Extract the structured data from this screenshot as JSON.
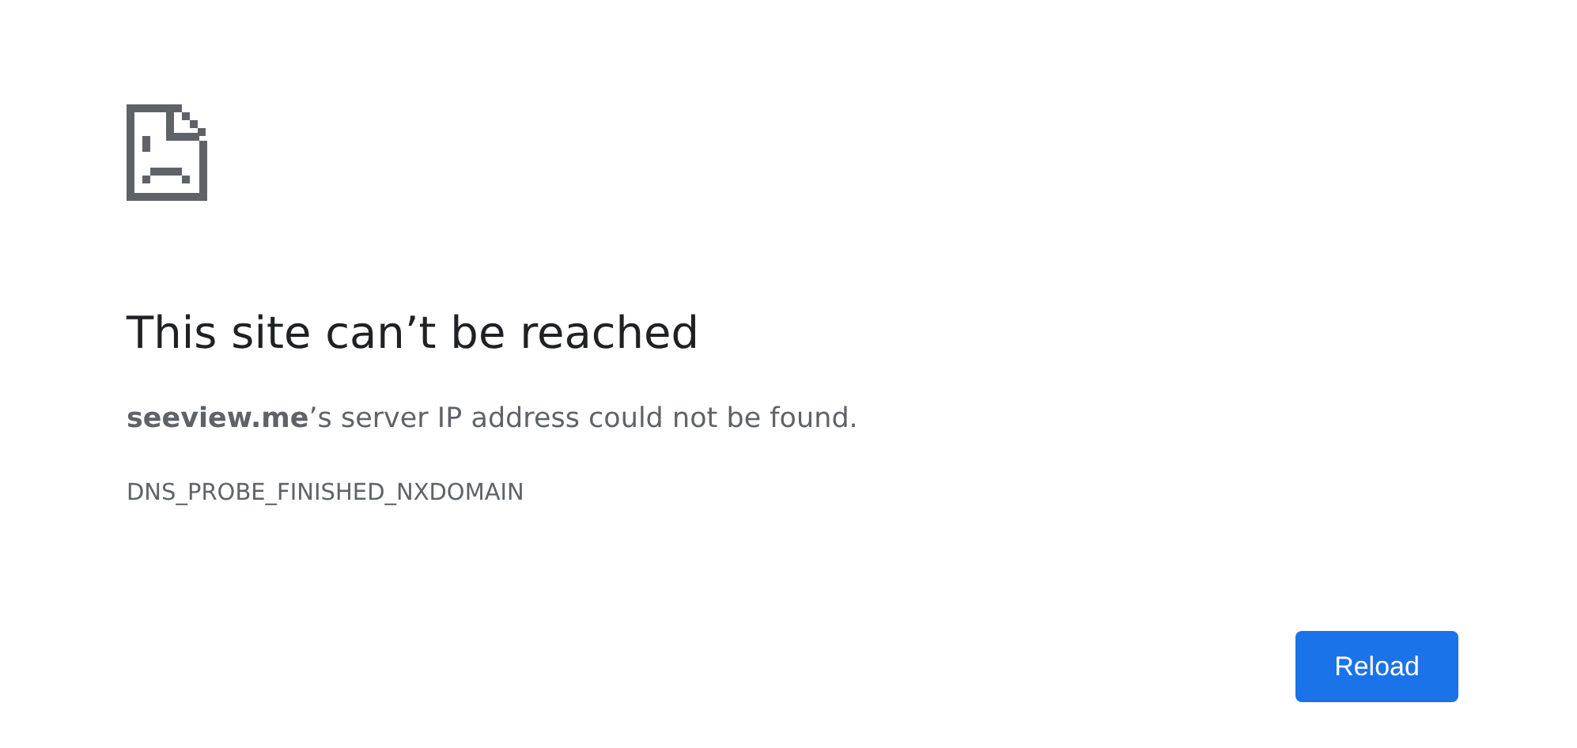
{
  "heading": "This site can’t be reached",
  "message": "**seeview.me**’s server IP address could not be found.",
  "error_code": "DNS_PROBE_FINISHED_NXDOMAIN",
  "buttons": [
    "Reload"
  ]
}
